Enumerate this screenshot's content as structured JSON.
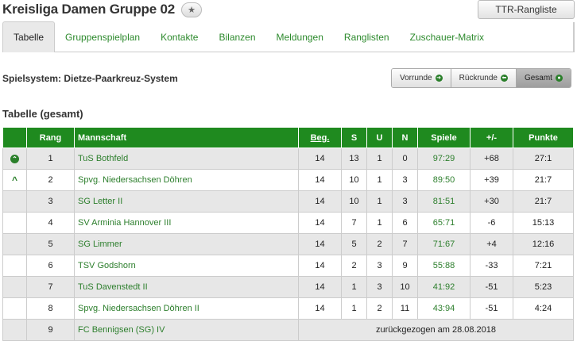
{
  "header": {
    "title": "Kreisliga Damen Gruppe 02",
    "star_icon": "star-icon",
    "ttr_button": "TTR-Rangliste"
  },
  "tabs": [
    {
      "label": "Tabelle",
      "active": true
    },
    {
      "label": "Gruppenspielplan"
    },
    {
      "label": "Kontakte"
    },
    {
      "label": "Bilanzen"
    },
    {
      "label": "Meldungen"
    },
    {
      "label": "Ranglisten"
    },
    {
      "label": "Zuschauer-Matrix"
    }
  ],
  "spielsystem": "Spielsystem: Dietze-Paarkreuz-System",
  "segment": [
    {
      "label": "Vorrunde",
      "icon": "arrow-right-icon",
      "glyph": "➜"
    },
    {
      "label": "Rückrunde",
      "icon": "arrow-left-icon",
      "glyph": "⬅"
    },
    {
      "label": "Gesamt",
      "icon": "circle-dot-icon",
      "glyph": "●",
      "active": true
    }
  ],
  "section_title": "Tabelle (gesamt)",
  "table": {
    "headers": {
      "rang": "Rang",
      "mannschaft": "Mannschaft",
      "beg": "Beg.",
      "s": "S",
      "u": "U",
      "n": "N",
      "spiele": "Spiele",
      "diff": "+/-",
      "punkte": "Punkte"
    },
    "rows": [
      {
        "indicator": "promotion-icon",
        "rang": "1",
        "team": "TuS Bothfeld",
        "beg": "14",
        "s": "13",
        "u": "1",
        "n": "0",
        "spiele": "97:29",
        "diff": "+68",
        "punkte": "27:1"
      },
      {
        "indicator": "caret-up-icon",
        "rang": "2",
        "team": "Spvg. Niedersachsen Döhren",
        "beg": "14",
        "s": "10",
        "u": "1",
        "n": "3",
        "spiele": "89:50",
        "diff": "+39",
        "punkte": "21:7"
      },
      {
        "indicator": "",
        "rang": "3",
        "team": "SG Letter II",
        "beg": "14",
        "s": "10",
        "u": "1",
        "n": "3",
        "spiele": "81:51",
        "diff": "+30",
        "punkte": "21:7"
      },
      {
        "indicator": "",
        "rang": "4",
        "team": "SV Arminia Hannover III",
        "beg": "14",
        "s": "7",
        "u": "1",
        "n": "6",
        "spiele": "65:71",
        "diff": "-6",
        "punkte": "15:13"
      },
      {
        "indicator": "",
        "rang": "5",
        "team": "SG Limmer",
        "beg": "14",
        "s": "5",
        "u": "2",
        "n": "7",
        "spiele": "71:67",
        "diff": "+4",
        "punkte": "12:16"
      },
      {
        "indicator": "",
        "rang": "6",
        "team": "TSV Godshorn",
        "beg": "14",
        "s": "2",
        "u": "3",
        "n": "9",
        "spiele": "55:88",
        "diff": "-33",
        "punkte": "7:21"
      },
      {
        "indicator": "",
        "rang": "7",
        "team": "TuS Davenstedt II",
        "beg": "14",
        "s": "1",
        "u": "3",
        "n": "10",
        "spiele": "41:92",
        "diff": "-51",
        "punkte": "5:23"
      },
      {
        "indicator": "",
        "rang": "8",
        "team": "Spvg. Niedersachsen Döhren II",
        "beg": "14",
        "s": "1",
        "u": "2",
        "n": "11",
        "spiele": "43:94",
        "diff": "-51",
        "punkte": "4:24"
      }
    ],
    "withdrawn": {
      "rang": "9",
      "team": "FC Bennigsen (SG) IV",
      "note": "zurückgezogen am 28.08.2018"
    }
  }
}
